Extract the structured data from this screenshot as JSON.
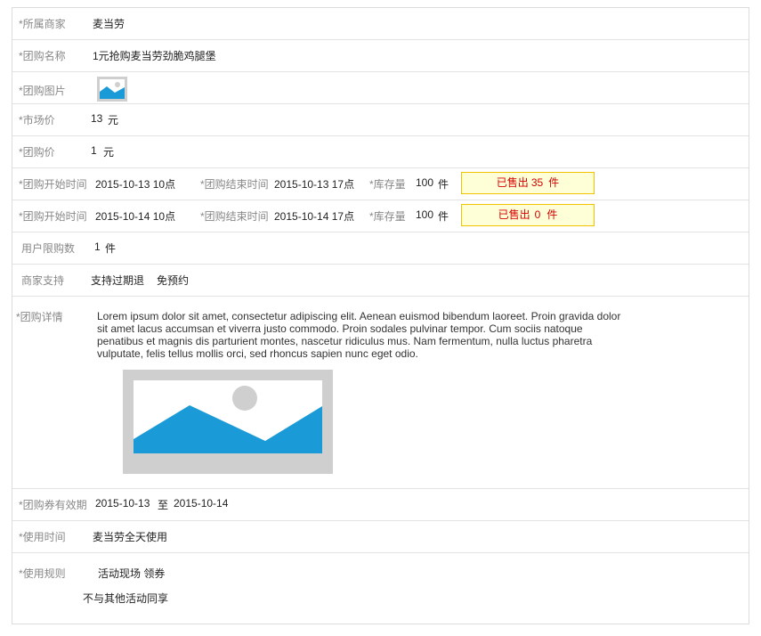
{
  "merchant": {
    "label": "*所属商家",
    "value": "麦当劳"
  },
  "deal_name": {
    "label": "*团购名称",
    "value": "1元抢购麦当劳劲脆鸡腿堡"
  },
  "deal_image": {
    "label": "*团购图片",
    "icon": "image-placeholder-icon"
  },
  "market_price": {
    "label": "*市场价",
    "value": "13",
    "unit": "元"
  },
  "deal_price": {
    "label": "*团购价",
    "value": "1",
    "unit": "元"
  },
  "sessions": [
    {
      "start_label": "*团购开始时间",
      "start": "2015-10-13 10点",
      "end_label": "*团购结束时间",
      "end": "2015-10-13 17点",
      "stock_label": "*库存量",
      "stock": "100",
      "stock_unit": "件",
      "sold_prefix": "已售出",
      "sold": "35",
      "sold_unit": "件"
    },
    {
      "start_label": "*团购开始时间",
      "start": "2015-10-14 10点",
      "end_label": "*团购结束时间",
      "end": "2015-10-14 17点",
      "stock_label": "*库存量",
      "stock": "100",
      "stock_unit": "件",
      "sold_prefix": "已售出",
      "sold": "0",
      "sold_unit": "件"
    }
  ],
  "user_limit": {
    "label": "用户限购数",
    "value": "1",
    "unit": "件"
  },
  "merchant_support": {
    "label": "商家支持",
    "items": [
      "支持过期退",
      "免预约"
    ]
  },
  "deal_details": {
    "label": "*团购详情",
    "text": "Lorem ipsum dolor sit amet, consectetur adipiscing elit. Aenean euismod bibendum laoreet. Proin gravida dolor sit amet lacus accumsan et viverra justo commodo. Proin sodales pulvinar tempor. Cum sociis natoque penatibus et magnis dis parturient montes, nascetur ridiculus mus. Nam fermentum, nulla luctus pharetra vulputate, felis tellus mollis orci, sed rhoncus sapien nunc eget odio.",
    "image_icon": "image-placeholder-icon"
  },
  "validity": {
    "label": "*团购券有效期",
    "from": "2015-10-13",
    "sep": "至",
    "to": "2015-10-14"
  },
  "usage_time": {
    "label": "*使用时间",
    "value": "麦当劳全天使用"
  },
  "usage_rules": {
    "label": "*使用规则",
    "lines": [
      "活动现场 领券",
      "不与其他活动同享"
    ]
  },
  "colors": {
    "accent_blue": "#1a9ad6",
    "sold_red": "#d40000",
    "sold_bg": "#ffffd7",
    "sold_border": "#f0c200"
  }
}
